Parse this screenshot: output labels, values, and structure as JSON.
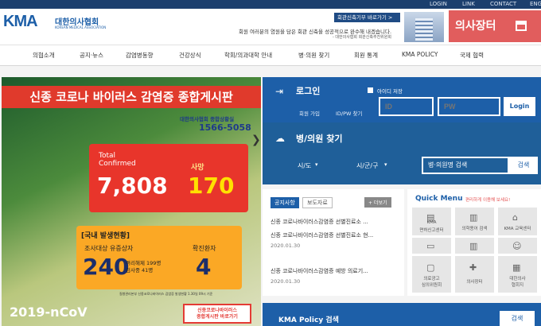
{
  "topnav": {
    "login": "LOGIN",
    "link": "LINK",
    "contact": "CONTACT",
    "eng": "ENG"
  },
  "header": {
    "logo": "KMA",
    "logo_ko": "대한의사협회",
    "logo_en": "KOREAN MEDICAL ASSOCIATION",
    "promo_button": "회관신축기부 바로가기 >",
    "promo_text": "회원 여러분의 염원을 담은 회관 신축을 성공적으로 완수해 내겠습니다.",
    "promo_sub": "- 대한의사협회 회관신축추진위원회",
    "doctor_market": "의사장터"
  },
  "nav": [
    "의협소개",
    "공지·뉴스",
    "감염병동향",
    "건강상식",
    "학회/의과대학 안내",
    "병·의원 찾기",
    "회원 통계",
    "KMA POLICY",
    "국제 협력"
  ],
  "banner": {
    "title": "신종 코로나 바이러스 감염증 종합게시판",
    "hotline_label": "대한의사협회 종합상황실",
    "hotline": "1566-5058",
    "total_label": "Total",
    "confirmed_label": "Confirmed",
    "confirmed": "7,808",
    "death_label": "사망",
    "death": "170",
    "domestic": "[국내 발생현황]",
    "suspect_label": "조사대상 유증상자",
    "suspect": "240",
    "suspect_note1": "격리해제 199명",
    "suspect_note2": "검사중 41명",
    "patients_label": "확진환자",
    "patients": "4",
    "source": "질병관리본부 신종코로나바이러스 감염증 발생현황 1.30일 09시 기준",
    "virus_label": "2019-nCoV",
    "corona_btn1": "신종코로나바이러스",
    "corona_btn2": "종합게시판 바로가기"
  },
  "login": {
    "title": "로그인",
    "save_id": "아이디 저장",
    "join": "회원 가입",
    "find": "ID/PW 찾기",
    "id_placeholder": "ID",
    "pw_placeholder": "PW",
    "button": "Login"
  },
  "hospital": {
    "title": "병/의원 찾기",
    "city": "시/도",
    "district": "시/군/구",
    "search_placeholder": "병·의원명 검색",
    "search_button": "검색"
  },
  "notice": {
    "tab_active": "공지사항",
    "tab2": "보도자료",
    "more": "+ 더보기",
    "items": [
      {
        "title": "신종 코로나바이러스감염증 선별진료소 ...",
        "date": ""
      },
      {
        "title": "신종 코로나바이러스감염증 선별진료소 현...",
        "date": "2020.01.30"
      },
      {
        "title": "신종 코로나바이러스감염증 예방 의료기...",
        "date": "2020.01.30"
      }
    ]
  },
  "quick": {
    "title": "Quick Menu",
    "subtitle": "편리하게 이용해 보세요!",
    "tiles": [
      {
        "label1": "KMA",
        "label2": "면허신고센터",
        "icon": "license-icon"
      },
      {
        "label1": "의학용어 검색",
        "label2": "",
        "icon": "book-icon"
      },
      {
        "label1": "KMA 교육센터",
        "label2": "",
        "icon": "graduation-icon"
      },
      {
        "label1": "",
        "label2": "",
        "icon": "money-icon"
      },
      {
        "label1": "",
        "label2": "",
        "icon": "book-icon"
      },
      {
        "label1": "",
        "label2": "",
        "icon": "user-icon"
      },
      {
        "label1": "의료광고",
        "label2": "심의위원회",
        "icon": "ad-icon"
      },
      {
        "label1": "의사장터",
        "label2": "",
        "icon": "medical-bag-icon"
      },
      {
        "label1": "대한의사",
        "label2": "협회지",
        "icon": "journal-icon"
      }
    ]
  },
  "policy": {
    "title": "KMA Policy 검색",
    "search": "검색"
  }
}
